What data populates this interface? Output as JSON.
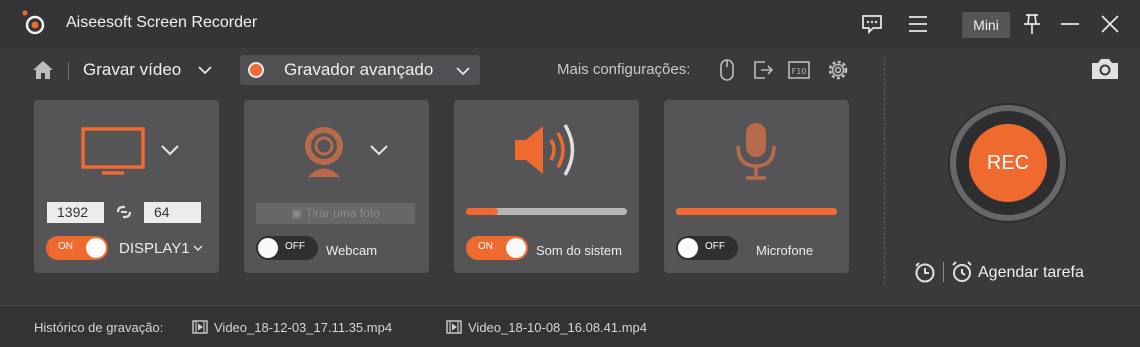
{
  "app": {
    "title": "Aiseesoft Screen Recorder"
  },
  "titlebar": {
    "mini_label": "Mini"
  },
  "toolbar": {
    "mode_label": "Gravar vídeo",
    "recorder_label": "Gravador avançado",
    "more_settings_label": "Mais configurações:"
  },
  "display": {
    "width": "1392",
    "height": "64",
    "toggle": "ON",
    "source_label": "DISPLAY1"
  },
  "webcam": {
    "photo_label": "Tirar uma foto",
    "toggle": "OFF",
    "label": "Webcam"
  },
  "system_sound": {
    "toggle": "ON",
    "label": "Som do sistem",
    "volume_percent": 20
  },
  "microphone": {
    "toggle": "OFF",
    "label": "Microfone",
    "volume_percent": 100
  },
  "rec": {
    "label": "REC"
  },
  "schedule": {
    "label": "Agendar tarefa"
  },
  "history": {
    "label": "Histórico de gravação:",
    "files": [
      "Video_18-12-03_17.11.35.mp4",
      "Video_18-10-08_16.08.41.mp4"
    ]
  },
  "colors": {
    "accent": "#ee6a2e",
    "panel": "#555558",
    "background": "#3a3a3c"
  }
}
